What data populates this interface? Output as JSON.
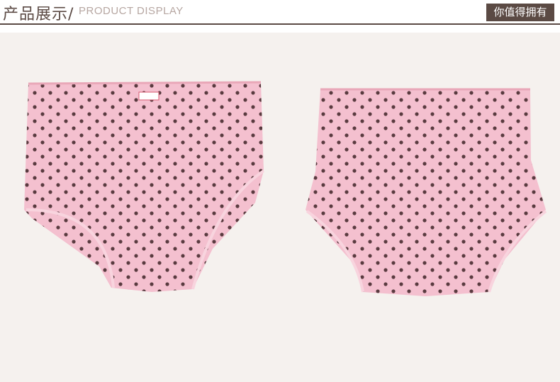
{
  "header": {
    "title_cn": "产品展示/",
    "title_en": "PRODUCT DISPLAY",
    "badge": "你值得拥有"
  },
  "photo": {
    "background_color": "#f5f1ee",
    "garment_color": "#f4c0cf",
    "dot_color": "#5a3b40"
  }
}
